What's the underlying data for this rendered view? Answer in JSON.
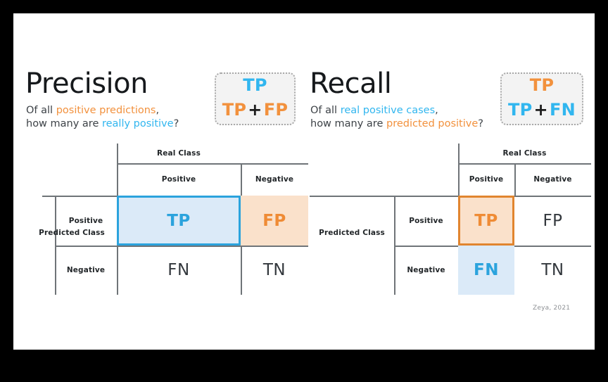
{
  "slide": {
    "background_color": "#000000",
    "canvas_color": "#ffffff",
    "signature": "Zeya, 2021"
  },
  "colors": {
    "blue": "#2ba3dd",
    "blue_light_fill": "#dbeaf8",
    "orange": "#ef8b35",
    "orange_light_fill": "#fae1cb",
    "heading": "#16191c",
    "subtitle": "#3d4247",
    "grid_line": "#6f7478",
    "card_fill": "#f3f3f3",
    "card_border": "#a8a8a8"
  },
  "precision": {
    "heading": "Precision",
    "subtitle_line1_prefix": "Of all ",
    "subtitle_line1_highlight": "positive predictions",
    "subtitle_line1_suffix": ",",
    "subtitle_line2_prefix": "how many are ",
    "subtitle_line2_highlight": "really positive",
    "subtitle_line2_suffix": "?",
    "formula": {
      "numerator": "TP",
      "denominator_left": "TP",
      "denominator_operator": "+",
      "denominator_right": "FP"
    }
  },
  "recall": {
    "heading": "Recall",
    "subtitle_line1_prefix": "Of all ",
    "subtitle_line1_highlight": "real positive cases",
    "subtitle_line1_suffix": ",",
    "subtitle_line2_prefix": "how many are ",
    "subtitle_line2_highlight": "predicted positive",
    "subtitle_line2_suffix": "?",
    "formula": {
      "numerator": "TP",
      "denominator_left": "TP",
      "denominator_operator": "+",
      "denominator_right": "FN"
    }
  },
  "matrix_left": {
    "column_axis_title": "Real Class",
    "row_axis_title": "Predicted Class",
    "column_headers": [
      "Positive",
      "Negative"
    ],
    "row_headers": [
      "Positive",
      "Negative"
    ],
    "cells": {
      "tp": "TP",
      "fp": "FP",
      "fn": "FN",
      "tn": "TN"
    },
    "highlight": "predicted-positive-row"
  },
  "matrix_right": {
    "column_axis_title": "Real Class",
    "row_axis_title": "Predicted Class",
    "column_headers": [
      "Positive",
      "Negative"
    ],
    "row_headers": [
      "Positive",
      "Negative"
    ],
    "cells": {
      "tp": "TP",
      "fp": "FP",
      "fn": "FN",
      "tn": "TN"
    },
    "highlight": "real-positive-column"
  }
}
